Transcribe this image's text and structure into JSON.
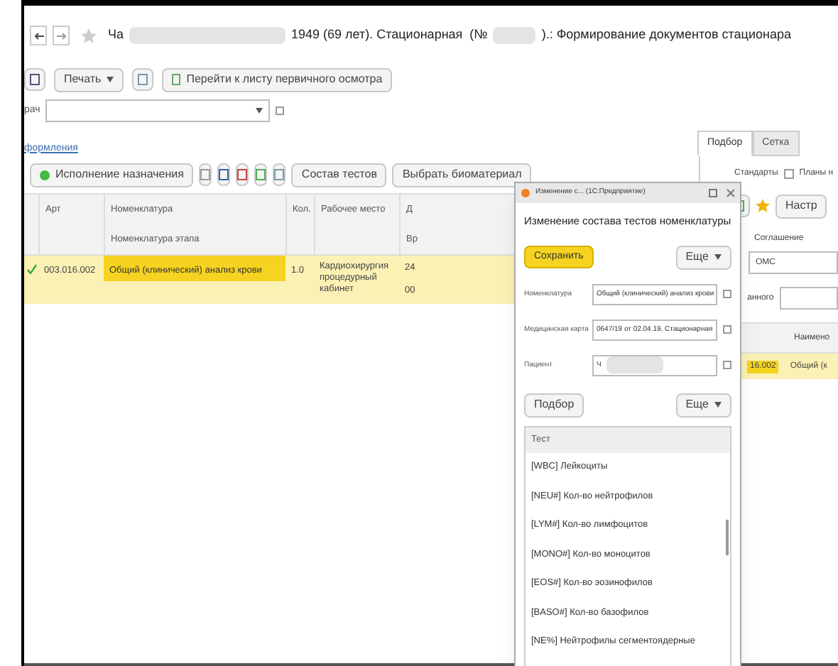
{
  "window": {
    "title_parts": [
      {
        "kind": "text",
        "text": "Ча"
      },
      {
        "kind": "redacted"
      },
      {
        "kind": "text",
        "text": "1949 (69 лет). Стационарная  (№"
      },
      {
        "kind": "redacted"
      },
      {
        "kind": "text",
        "text": ").: Формирование документов стационара"
      }
    ]
  },
  "toolbar": {
    "print": "Печать",
    "go_to": "Перейти к листу первичного осмотра"
  },
  "doctor_field": {
    "label": "рач"
  },
  "link": "формления",
  "tabs": [
    {
      "label": "Подбор",
      "selected": true
    },
    {
      "label": "Сетка",
      "selected": false
    }
  ],
  "actions": {
    "execute": "Исполнение назначения",
    "tests": "Состав тестов",
    "biomaterial": "Выбрать биоматериал"
  },
  "table": {
    "columns": [
      {
        "label": "Арт"
      },
      {
        "label": "Номенклатура",
        "sub": "Номенклатура этапа"
      },
      {
        "label": "Кол."
      },
      {
        "label": "Рабочее место"
      },
      {
        "label": "Д",
        "sub": "Вр"
      }
    ],
    "rows": [
      {
        "done": true,
        "selected": true,
        "art": "003.016.002",
        "name": "Общий (клинический) анализ крови",
        "qty": "1.0",
        "place": "Кардиохирургия процедурный кабинет",
        "date": "24",
        "time": "00"
      }
    ]
  },
  "right_panel": {
    "standards": "Стандарты",
    "plans": {
      "label": "Планы н",
      "checked": false
    },
    "settings": "Настр",
    "agreement_label": "Соглашение",
    "agreement_value": "ОМС",
    "field_label": "анного",
    "column": "Наимено",
    "row": {
      "art": "16.002",
      "name": "Общий (к",
      "selected": true
    }
  },
  "dialog": {
    "title": "Изменение с... (1С:Предприятие)",
    "heading": "Изменение состава тестов номенклатуры",
    "save": "Сохранить",
    "more": "Еще",
    "fields": [
      {
        "label": "Номенклатура",
        "value": "Общий (клинический) анализ крови"
      },
      {
        "label": "Медицинская карта",
        "value": "0647/19 от 02.04.19, Стационарная"
      },
      {
        "label": "Пациент",
        "value": "Ч",
        "redacted": true
      }
    ],
    "pick": "Подбор",
    "more2": "Еще",
    "list_header": "Тест",
    "items": [
      "[WBC] Лейкоциты",
      "[NEU#] Кол-во нейтрофилов",
      "[LYM#] Кол-во лимфоцитов",
      "[MONO#] Кол-во моноцитов",
      "[EOS#] Кол-во эозинофилов",
      "[BASO#] Кол-во базофилов",
      "[NE%] Нейтрофилы сегментоядерные"
    ]
  }
}
